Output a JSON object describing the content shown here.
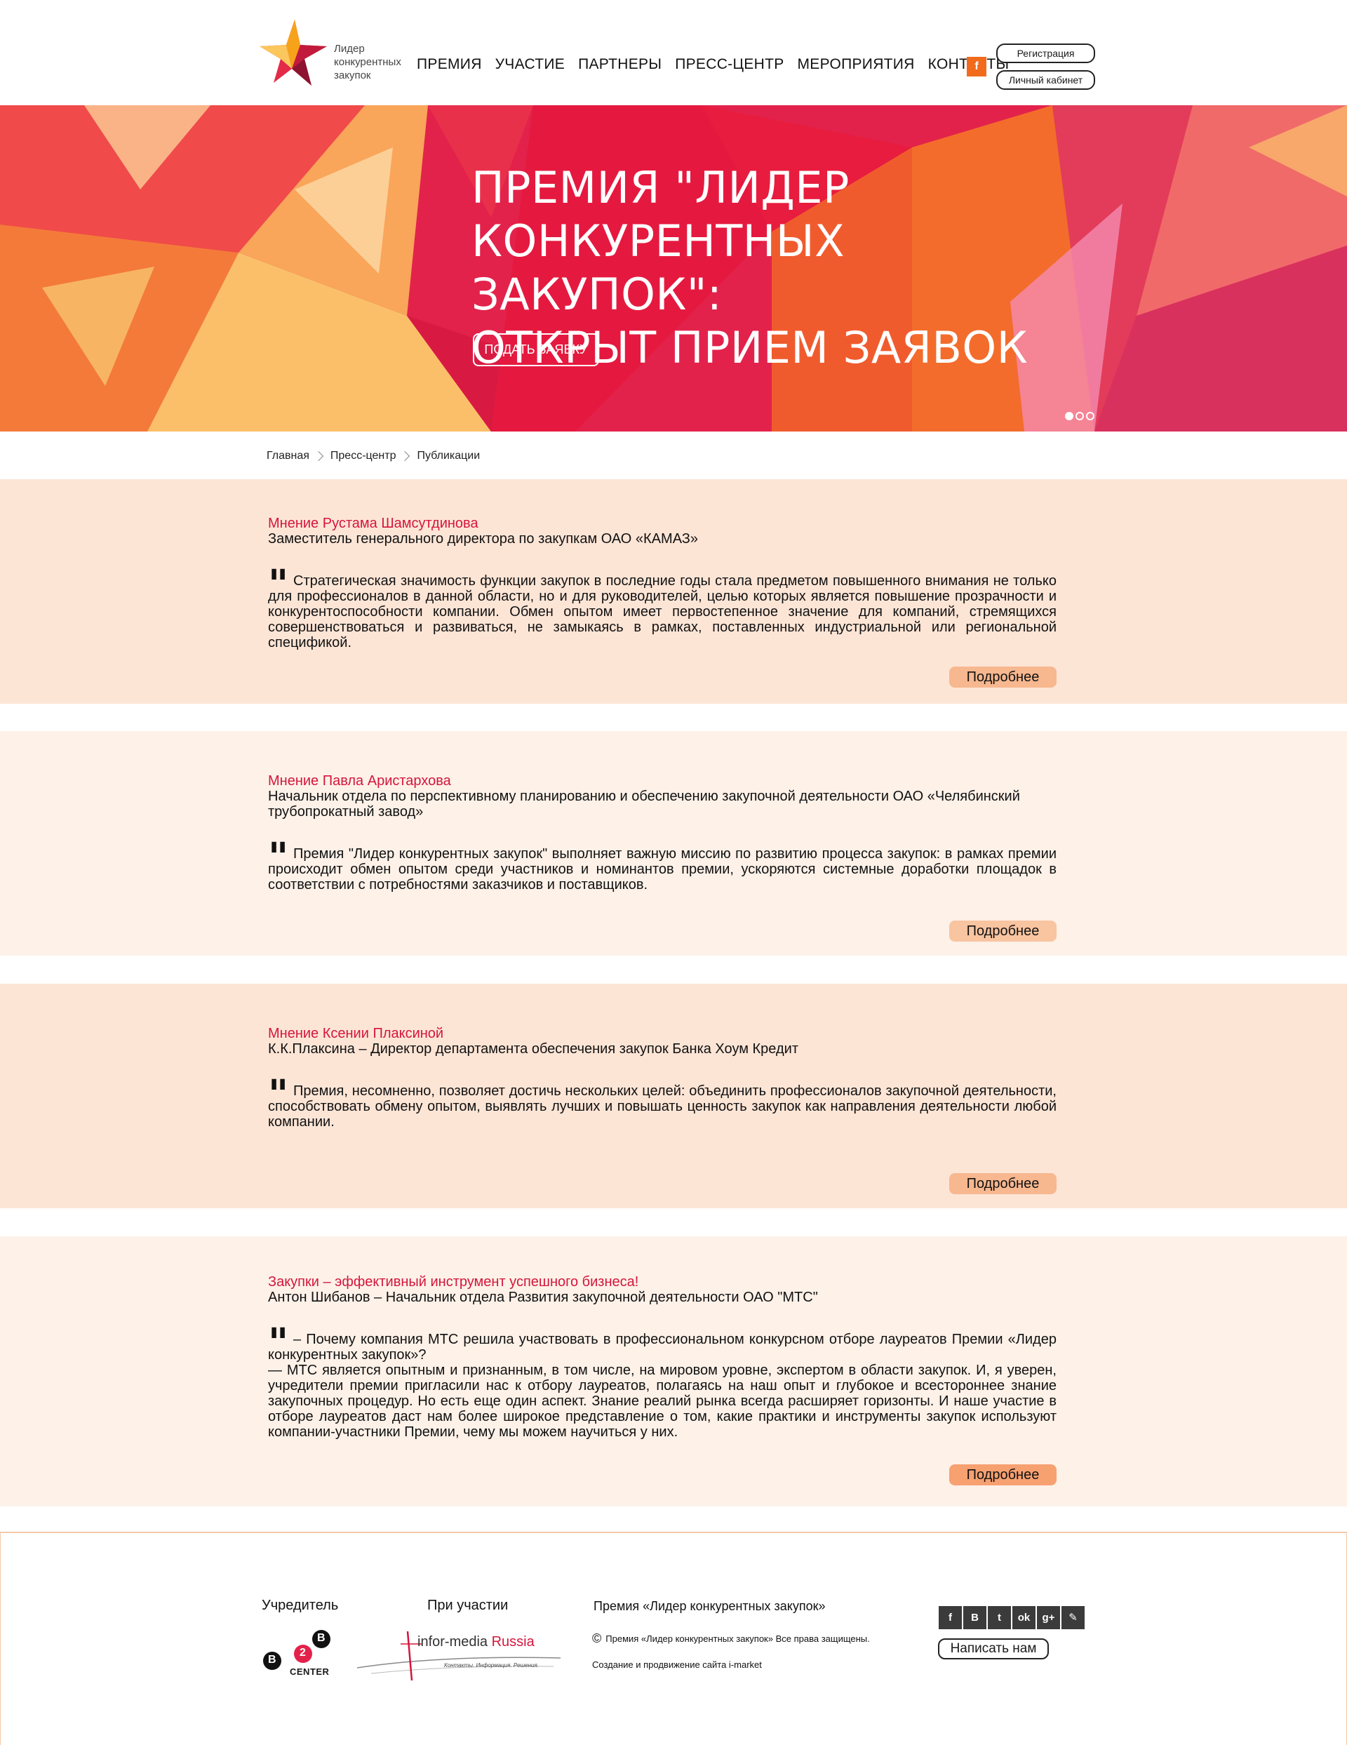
{
  "header": {
    "logo_text": "Лидер конкурентных закупок",
    "nav": [
      "ПРЕМИЯ",
      "УЧАСТИЕ",
      "ПАРТНЕРЫ",
      "ПРЕСС-ЦЕНТР",
      "МЕРОПРИЯТИЯ",
      "КОНТАКТЫ"
    ],
    "facebook_label": "f",
    "register_label": "Регистрация",
    "cabinet_label": "Личный кабинет"
  },
  "hero": {
    "title_line1": "ПРЕМИЯ \"ЛИДЕР",
    "title_line2": "КОНКУРЕНТНЫХ ЗАКУПОК\":",
    "title_line3": "ОТКРЫТ ПРИЕМ ЗАЯВОК",
    "button_label": "ПОДАТЬ ЗАЯВКУ"
  },
  "breadcrumb": [
    "Главная",
    "Пресс-центр",
    "Публикации"
  ],
  "articles": [
    {
      "title": "Мнение Рустама Шамсутдинова",
      "subtitle": "Заместитель генерального директора по закупкам ОАО «КАМАЗ»",
      "quote": "Стратегическая значимость функции закупок в последние годы стала предметом повышенного внимания не только для профессионалов в данной области, но и для руководителей, целью которых является повышение прозрачности и конкурентоспособности компании. Обмен опытом имеет первостепенное значение для компаний, стремящихся совершенствоваться и развиваться, не замыкаясь в рамках, поставленных индустриальной или региональной спецификой.",
      "more": "Подробнее"
    },
    {
      "title": "Мнение Павла Аристархова",
      "subtitle": " Начальник отдела по перспективному планированию и обеспечению закупочной деятельности ОАО «Челябинский трубопрокатный завод»",
      "quote": "Премия \"Лидер конкурентных закупок\" выполняет важную миссию по развитию процесса закупок: в рамках премии происходит обмен опытом среди участников и номинантов премии, ускоряются системные доработки площадок в соответствии с потребностями заказчиков и поставщиков.",
      "more": "Подробнее"
    },
    {
      "title": "Мнение Ксении Плаксиной",
      "subtitle": "К.К.Плаксина – Директор департамента обеспечения закупок Банка Хоум Кредит",
      "quote": "Премия, несомненно, позволяет достичь нескольких целей: объединить профессионалов закупочной деятельности, способствовать обмену опытом, выявлять лучших и повышать ценность закупок как направления деятельности любой компании.",
      "more": "Подробнее"
    },
    {
      "title": "Закупки – эффективный инструмент успешного бизнеса!",
      "subtitle": "Антон Шибанов – Начальник отдела Развития закупочной деятельности ОАО \"МТС\"",
      "quote": "– Почему компания МТС решила участвовать в профессиональном конкурсном отборе лауреатов Премии «Лидер конкурентных закупок»?",
      "quote2": "— МТС является опытным и признанным, в том числе, на мировом уровне, экспертом в области закупок. И, я уверен, учредители премии пригласили нас к отбору лауреатов, полагаясь на наш опыт и глубокое и всестороннее знание закупочных процедур. Но есть еще один аспект. Знание реалий рынка всегда расширяет горизонты. И наше участие в отборе лауреатов даст нам более широкое представление о том, какие практики и инструменты закупок используют компании-участники Премии, чему мы можем научиться у них.",
      "more": "Подробнее"
    }
  ],
  "footer": {
    "founder_label": "Учредитель",
    "b2b_center": "CENTER",
    "b2b_num": "2",
    "b2b_letter": "B",
    "participation_label": "При участии",
    "infor_logo_main": "infor-media",
    "infor_logo_accent": "Russia",
    "infor_tagline": "Контакты. Информация. Решения.",
    "prize_label": "Премия «Лидер конкурентных закупок»",
    "copyright": "Премия «Лидер конкурентных закупок» Все права защищены.",
    "copyright_symbol": "©",
    "credits": "Создание и продвижение сайта i-market",
    "social": [
      "f",
      "В",
      "t",
      "ok",
      "g+",
      "✎"
    ],
    "write_label": "Написать нам"
  },
  "colors": {
    "accent": "#d4163c",
    "orange": "#f26b1d",
    "bg_dark": "#fde5d6",
    "bg_light": "#fdf1e8",
    "button": "#f7b78f"
  }
}
